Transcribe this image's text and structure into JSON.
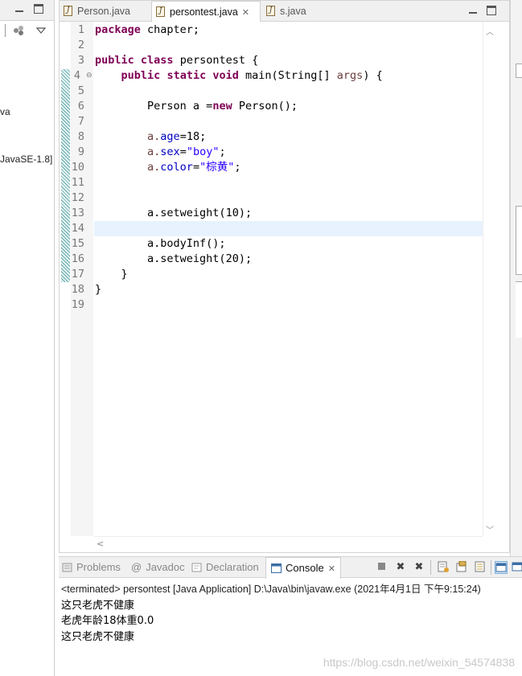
{
  "left_pane": {
    "text_fragment_1": "va",
    "text_fragment_2": "JavaSE-1.8]"
  },
  "editor": {
    "tabs": [
      {
        "label": "Person.java",
        "active": false
      },
      {
        "label": "persontest.java",
        "active": true
      },
      {
        "label": "s.java",
        "active": false
      }
    ],
    "tab_close_glyph": "✕",
    "line_numbers": [
      "1",
      "2",
      "3",
      "4",
      "5",
      "6",
      "7",
      "8",
      "9",
      "10",
      "11",
      "12",
      "13",
      "14",
      "15",
      "16",
      "17",
      "18",
      "19"
    ],
    "lines": {
      "l1_kw": "package",
      "l1_rest": " chapter;",
      "l3_kw1": "public",
      "l3_kw2": "class",
      "l3_rest": " persontest {",
      "l4_kw1": "public",
      "l4_kw2": "static",
      "l4_kw3": "void",
      "l4_rest1": " main(String[] ",
      "l4_arg": "args",
      "l4_rest2": ") {",
      "l6_a": "Person a =",
      "l6_kw": "new",
      "l6_b": " Person();",
      "l8_obj": "a.",
      "l8_field": "age",
      "l8_rest": "=18;",
      "l9_obj": "a.",
      "l9_field": "sex",
      "l9_eq": "=",
      "l9_str": "\"boy\"",
      "l9_end": ";",
      "l10_obj": "a.",
      "l10_field": "color",
      "l10_eq": "=",
      "l10_str": "\"棕黄\"",
      "l10_end": ";",
      "l13": "a.setweight(10);",
      "l15": "a.bodyInf();",
      "l16": "a.setweight(20);",
      "l17": "}",
      "l18": "}"
    }
  },
  "console": {
    "tabs": [
      {
        "label": "Problems",
        "active": false
      },
      {
        "label": "Javadoc",
        "active": false
      },
      {
        "label": "Declaration",
        "active": false
      },
      {
        "label": "Console",
        "active": true
      }
    ],
    "javadoc_glyph": "@",
    "status": "<terminated> persontest [Java Application] D:\\Java\\bin\\javaw.exe (2021年4月1日 下午9:15:24)",
    "output": [
      "这只老虎不健康",
      "老虎年龄18体重0.0",
      "这只老虎不健康"
    ],
    "watermark": "https://blog.csdn.net/weixin_54574838"
  },
  "icons": [
    "minimize-icon",
    "maximize-icon",
    "java-file-icon",
    "close-icon",
    "collapse-icon",
    "view-menu-icon",
    "problems-icon",
    "declaration-icon",
    "console-icon",
    "terminate-icon",
    "remove-launch-icon",
    "remove-all-icon",
    "scroll-lock-icon",
    "pin-icon",
    "display-console-icon",
    "open-console-icon",
    "scroll-up-icon",
    "scroll-down-icon",
    "scroll-left-icon",
    "fold-icon"
  ]
}
